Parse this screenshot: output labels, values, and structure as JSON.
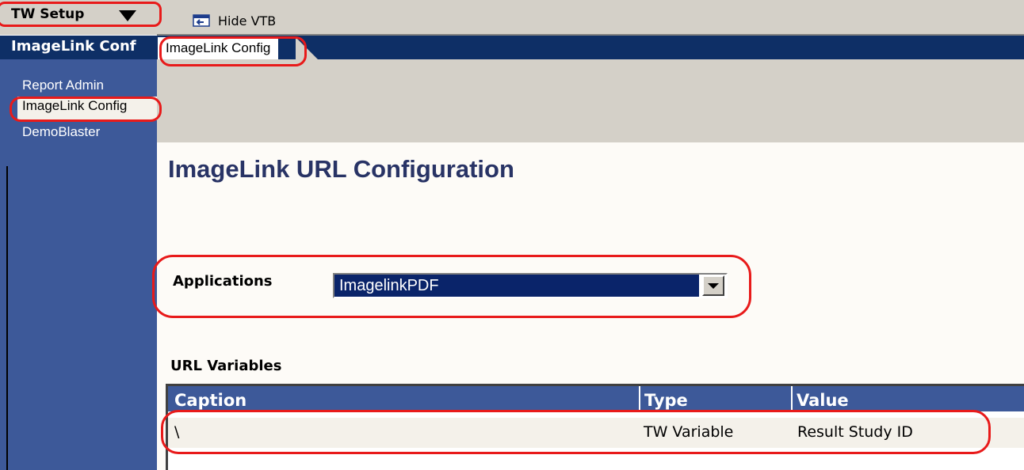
{
  "header": {
    "menu_label": "TW Setup",
    "hide_vtb_label": "Hide VTB"
  },
  "sidebar": {
    "title": "ImageLink Conf",
    "items": [
      {
        "label": "Report Admin"
      },
      {
        "label": "ImageLink Config"
      },
      {
        "label": "DemoBlaster"
      }
    ]
  },
  "tabs": [
    {
      "label": "ImageLink Config"
    }
  ],
  "main": {
    "title": "ImageLink URL Configuration",
    "applications_label": "Applications",
    "applications_value": "ImagelinkPDF",
    "url_variables_label": "URL Variables",
    "grid": {
      "columns": [
        "Caption",
        "Type",
        "Value"
      ],
      "rows": [
        [
          "\\",
          "TW Variable",
          "Result Study ID"
        ]
      ]
    }
  },
  "colors": {
    "header_blue": "#0e2f66",
    "sidebar_blue": "#3d5999",
    "highlight_red": "#e81a1a",
    "title_color": "#283365"
  },
  "icons": {
    "hide_vtb": "hide-panel-icon",
    "menu_dropdown": "dropdown-arrow-icon"
  }
}
